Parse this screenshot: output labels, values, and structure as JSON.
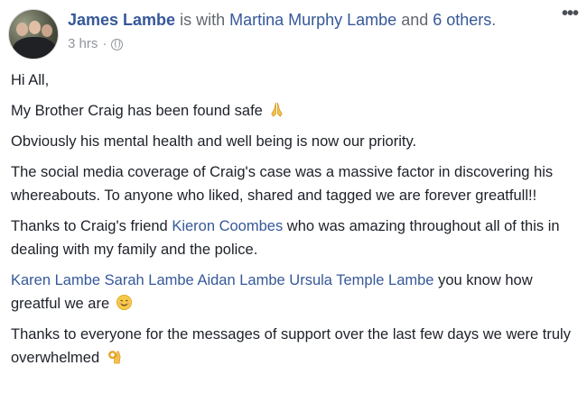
{
  "header": {
    "author": "James Lambe",
    "with_text": " is with ",
    "tagged_person": "Martina Murphy Lambe",
    "and_text": " and ",
    "others": "6 others",
    "period": ".",
    "time": "3 hrs",
    "dot": "·",
    "privacy_icon": "globe-icon",
    "menu_icon": "more-options-icon",
    "menu_glyph": "•••"
  },
  "post": {
    "greeting": "Hi All,",
    "found_safe": "My Brother Craig has been found safe",
    "priority": "Obviously his mental health and well being is now our priority.",
    "coverage": "The social media coverage of Craig's case was a massive factor in discovering his whereabouts. To anyone who liked, shared and tagged we are forever greatfull!!",
    "thanks_prefix": "Thanks to Craig's friend ",
    "friend": "Kieron Coombes",
    "thanks_suffix": " who was amazing throughout all of this in dealing with my family and the police.",
    "family_tags": [
      "Karen Lambe",
      "Sarah Lambe",
      "Aidan Lambe",
      "Ursula Temple Lambe"
    ],
    "family_suffix": " you know how greatful we are ",
    "closing": "Thanks to everyone for the messages of support over the last few days we were truly overwhelmed ",
    "emojis": [
      "praying-hands-icon",
      "smiling-face-icon",
      "ok-hand-icon"
    ]
  }
}
